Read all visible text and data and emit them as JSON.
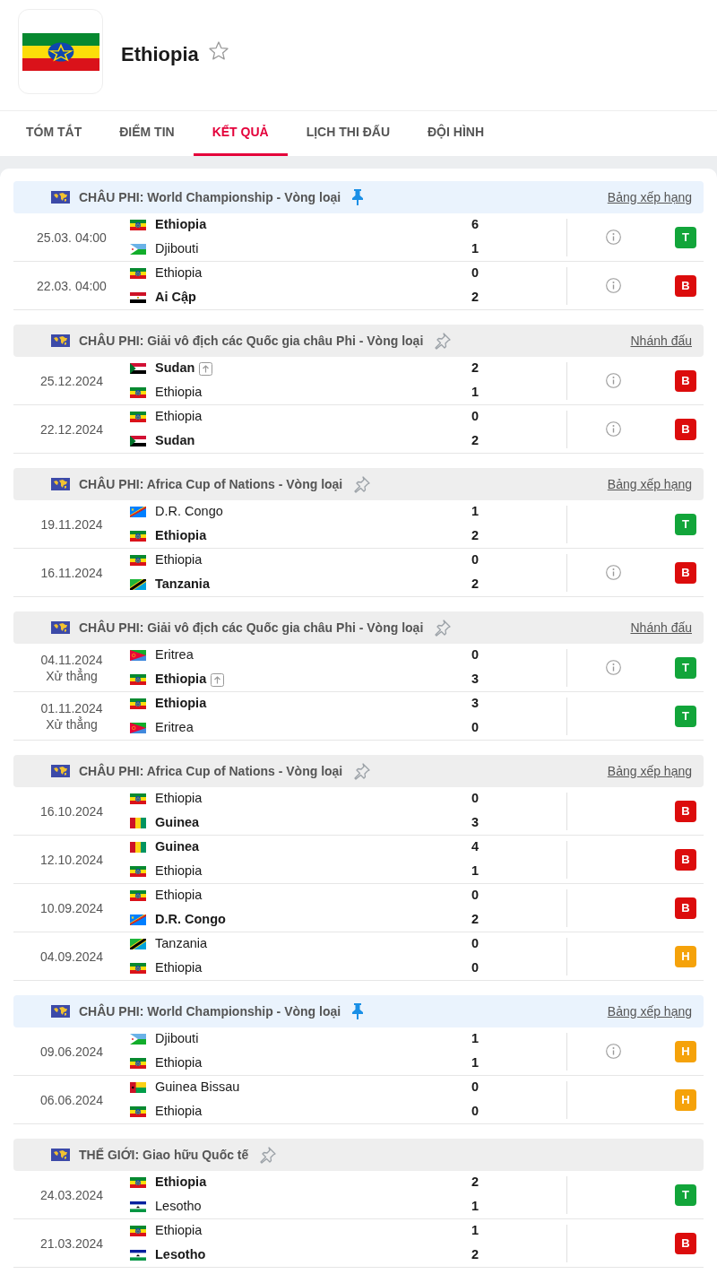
{
  "team": {
    "name": "Ethiopia",
    "kind": "eth"
  },
  "tabs": [
    {
      "label": "TÓM TẮT",
      "selected": false
    },
    {
      "label": "ĐIỂM TIN",
      "selected": false
    },
    {
      "label": "KẾT QUẢ",
      "selected": true
    },
    {
      "label": "LỊCH THI ĐẤU",
      "selected": false
    },
    {
      "label": "ĐỘI HÌNH",
      "selected": false
    }
  ],
  "sections": [
    {
      "title": "CHÂU PHI: World Championship - Vòng loại",
      "pinned": true,
      "link": "Bảng xếp hạng",
      "matches": [
        {
          "date": "25.03. 04:00",
          "info": true,
          "result": "T",
          "color": "#12a53a",
          "teams": [
            {
              "name": "Ethiopia",
              "kind": "eth",
              "bold": true,
              "advanced": false,
              "score": "6"
            },
            {
              "name": "Djibouti",
              "kind": "dji",
              "bold": false,
              "advanced": false,
              "score": "1"
            }
          ]
        },
        {
          "date": "22.03. 04:00",
          "info": true,
          "result": "B",
          "color": "#dc0c0c",
          "teams": [
            {
              "name": "Ethiopia",
              "kind": "eth",
              "bold": false,
              "advanced": false,
              "score": "0"
            },
            {
              "name": "Ai Cập",
              "kind": "egy",
              "bold": true,
              "advanced": false,
              "score": "2"
            }
          ]
        }
      ]
    },
    {
      "title": "CHÂU PHI: Giải vô địch các Quốc gia châu Phi - Vòng loại",
      "pinned": false,
      "link": "Nhánh đấu",
      "matches": [
        {
          "date": "25.12.2024",
          "info": true,
          "result": "B",
          "color": "#dc0c0c",
          "teams": [
            {
              "name": "Sudan",
              "kind": "sud",
              "bold": true,
              "advanced": true,
              "score": "2"
            },
            {
              "name": "Ethiopia",
              "kind": "eth",
              "bold": false,
              "advanced": false,
              "score": "1"
            }
          ]
        },
        {
          "date": "22.12.2024",
          "info": true,
          "result": "B",
          "color": "#dc0c0c",
          "teams": [
            {
              "name": "Ethiopia",
              "kind": "eth",
              "bold": false,
              "advanced": false,
              "score": "0"
            },
            {
              "name": "Sudan",
              "kind": "sud",
              "bold": true,
              "advanced": false,
              "score": "2"
            }
          ]
        }
      ]
    },
    {
      "title": "CHÂU PHI: Africa Cup of Nations - Vòng loại",
      "pinned": false,
      "link": "Bảng xếp hạng",
      "matches": [
        {
          "date": "19.11.2024",
          "info": false,
          "result": "T",
          "color": "#12a53a",
          "teams": [
            {
              "name": "D.R. Congo",
              "kind": "cod",
              "bold": false,
              "advanced": false,
              "score": "1"
            },
            {
              "name": "Ethiopia",
              "kind": "eth",
              "bold": true,
              "advanced": false,
              "score": "2"
            }
          ]
        },
        {
          "date": "16.11.2024",
          "info": true,
          "result": "B",
          "color": "#dc0c0c",
          "teams": [
            {
              "name": "Ethiopia",
              "kind": "eth",
              "bold": false,
              "advanced": false,
              "score": "0"
            },
            {
              "name": "Tanzania",
              "kind": "tza",
              "bold": true,
              "advanced": false,
              "score": "2"
            }
          ]
        }
      ]
    },
    {
      "title": "CHÂU PHI: Giải vô địch các Quốc gia châu Phi - Vòng loại",
      "pinned": false,
      "link": "Nhánh đấu",
      "matches": [
        {
          "date": "04.11.2024",
          "note": "Xử thẳng",
          "info": true,
          "result": "T",
          "color": "#12a53a",
          "teams": [
            {
              "name": "Eritrea",
              "kind": "eri",
              "bold": false,
              "advanced": false,
              "score": "0"
            },
            {
              "name": "Ethiopia",
              "kind": "eth",
              "bold": true,
              "advanced": true,
              "score": "3"
            }
          ]
        },
        {
          "date": "01.11.2024",
          "note": "Xử thẳng",
          "info": false,
          "result": "T",
          "color": "#12a53a",
          "teams": [
            {
              "name": "Ethiopia",
              "kind": "eth",
              "bold": true,
              "advanced": false,
              "score": "3"
            },
            {
              "name": "Eritrea",
              "kind": "eri",
              "bold": false,
              "advanced": false,
              "score": "0"
            }
          ]
        }
      ]
    },
    {
      "title": "CHÂU PHI: Africa Cup of Nations - Vòng loại",
      "pinned": false,
      "link": "Bảng xếp hạng",
      "matches": [
        {
          "date": "16.10.2024",
          "info": false,
          "result": "B",
          "color": "#dc0c0c",
          "teams": [
            {
              "name": "Ethiopia",
              "kind": "eth",
              "bold": false,
              "advanced": false,
              "score": "0"
            },
            {
              "name": "Guinea",
              "kind": "gin",
              "bold": true,
              "advanced": false,
              "score": "3"
            }
          ]
        },
        {
          "date": "12.10.2024",
          "info": false,
          "result": "B",
          "color": "#dc0c0c",
          "teams": [
            {
              "name": "Guinea",
              "kind": "gin",
              "bold": true,
              "advanced": false,
              "score": "4"
            },
            {
              "name": "Ethiopia",
              "kind": "eth",
              "bold": false,
              "advanced": false,
              "score": "1"
            }
          ]
        },
        {
          "date": "10.09.2024",
          "info": false,
          "result": "B",
          "color": "#dc0c0c",
          "teams": [
            {
              "name": "Ethiopia",
              "kind": "eth",
              "bold": false,
              "advanced": false,
              "score": "0"
            },
            {
              "name": "D.R. Congo",
              "kind": "cod",
              "bold": true,
              "advanced": false,
              "score": "2"
            }
          ]
        },
        {
          "date": "04.09.2024",
          "info": false,
          "result": "H",
          "color": "#f5a20a",
          "teams": [
            {
              "name": "Tanzania",
              "kind": "tza",
              "bold": false,
              "advanced": false,
              "score": "0"
            },
            {
              "name": "Ethiopia",
              "kind": "eth",
              "bold": false,
              "advanced": false,
              "score": "0"
            }
          ]
        }
      ]
    },
    {
      "title": "CHÂU PHI: World Championship - Vòng loại",
      "pinned": true,
      "link": "Bảng xếp hạng",
      "matches": [
        {
          "date": "09.06.2024",
          "info": true,
          "result": "H",
          "color": "#f5a20a",
          "teams": [
            {
              "name": "Djibouti",
              "kind": "dji",
              "bold": false,
              "advanced": false,
              "score": "1"
            },
            {
              "name": "Ethiopia",
              "kind": "eth",
              "bold": false,
              "advanced": false,
              "score": "1"
            }
          ]
        },
        {
          "date": "06.06.2024",
          "info": false,
          "result": "H",
          "color": "#f5a20a",
          "teams": [
            {
              "name": "Guinea Bissau",
              "kind": "gnb",
              "bold": false,
              "advanced": false,
              "score": "0"
            },
            {
              "name": "Ethiopia",
              "kind": "eth",
              "bold": false,
              "advanced": false,
              "score": "0"
            }
          ]
        }
      ]
    },
    {
      "title": "THẾ GIỚI: Giao hữu Quốc tế",
      "pinned": false,
      "matches": [
        {
          "date": "24.03.2024",
          "info": false,
          "result": "T",
          "color": "#12a53a",
          "teams": [
            {
              "name": "Ethiopia",
              "kind": "eth",
              "bold": true,
              "advanced": false,
              "score": "2"
            },
            {
              "name": "Lesotho",
              "kind": "lso",
              "bold": false,
              "advanced": false,
              "score": "1"
            }
          ]
        },
        {
          "date": "21.03.2024",
          "info": false,
          "result": "B",
          "color": "#dc0c0c",
          "teams": [
            {
              "name": "Ethiopia",
              "kind": "eth",
              "bold": false,
              "advanced": false,
              "score": "1"
            },
            {
              "name": "Lesotho",
              "kind": "lso",
              "bold": true,
              "advanced": false,
              "score": "2"
            }
          ]
        }
      ]
    }
  ]
}
